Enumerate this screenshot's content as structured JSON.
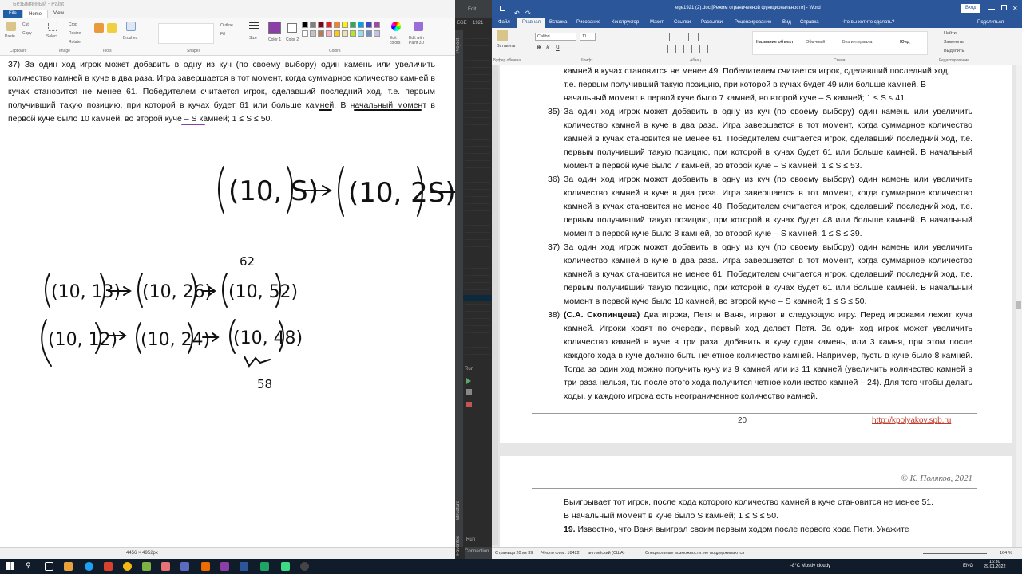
{
  "paint": {
    "title": "Безымянный - Paint",
    "tabs": [
      "File",
      "Home",
      "View"
    ],
    "ribbon": {
      "paste": "Paste",
      "cut": "Cut",
      "copy": "Copy",
      "select": "Select",
      "crop": "Crop",
      "resize": "Resize",
      "rotate": "Rotate",
      "brushes": "Brushes",
      "outline": "Outline",
      "fill": "Fill",
      "size": "Size",
      "color1": "Color 1",
      "color2": "Color 2",
      "edit_colors": "Edit colors",
      "edit_paint3d": "Edit with Paint 3D",
      "groups": [
        "Clipboard",
        "Image",
        "Tools",
        "Shapes",
        "Colors"
      ]
    },
    "task_text": "37) За один ход игрок может добавить в одну из куч (по своему выбору) один камень или увеличить количество камней в куче в два раза. Игра завершается в тот момент, когда суммарное количество камней в кучах становится не менее 61. Победителем считается игрок, сделавший последний ход, т.е. первым получивший такую позицию, при которой в кучах будет 61 или больше камней. В начальный момент в первой куче было 10 камней, во второй куче – S камней; 1 ≤ S ≤ 50.",
    "handwriting": {
      "line1_a": "(10, S)",
      "line1_b": "(10, 2S)",
      "label_62": "62",
      "row2": [
        "(10, 13)",
        "(10, 26)",
        "(10, 52)"
      ],
      "row3": [
        "(10, 12)",
        "(10, 24)",
        "(10, 48)"
      ],
      "label_58": "58"
    },
    "status": {
      "size": "4456 × 4952px"
    }
  },
  "ide": {
    "tabs": [
      "Edit",
      "EGE",
      "1921"
    ],
    "panel": "Run",
    "side_labels": [
      "Project",
      "Structure",
      "Favorites"
    ],
    "status": "Connection"
  },
  "word": {
    "title": "ege1921 (2).doc [Режим ограниченной функциональности] - Word",
    "login": "Вход",
    "tabs": [
      "Файл",
      "Главная",
      "Вставка",
      "Рисование",
      "Конструктор",
      "Макет",
      "Ссылки",
      "Рассылки",
      "Рецензирование",
      "Вид",
      "Справка",
      "Что вы хотите сделать?",
      "Поделиться"
    ],
    "ribbon": {
      "paste": "Вставить",
      "font_name": "Calibri",
      "font_size": "11",
      "styles": [
        "Название объект",
        "Обычный",
        "Без интервала",
        "Ючд"
      ],
      "find": "Найти",
      "replace": "Заменить",
      "select": "Выделить",
      "groups": [
        "Буфер обмена",
        "Шрифт",
        "Абзац",
        "Стили",
        "Редактирование"
      ]
    },
    "page1": {
      "top_lines": [
        "камней в кучах становится не менее 49. Победителем считается игрок, сделавший последний ход,",
        "т.е. первым получивший такую позицию, при которой в кучах будет 49 или больше камней. В",
        "начальный момент в первой куче было 7 камней, во второй куче – S камней; 1 ≤ S ≤ 41."
      ],
      "items": [
        {
          "num": "35)",
          "text": "За один ход игрок может добавить в одну из куч (по своему выбору) один камень или увеличить количество камней в куче в два раза. Игра завершается в тот момент, когда суммарное количество камней в кучах становится не менее 61. Победителем считается игрок, сделавший последний ход, т.е. первым получивший такую позицию, при которой в кучах будет 61 или больше камней. В начальный момент в первой куче было 7 камней, во второй куче – S камней; 1 ≤ S ≤ 53."
        },
        {
          "num": "36)",
          "text": "За один ход игрок может добавить в одну из куч (по своему выбору) один камень или увеличить количество камней в куче в два раза. Игра завершается в тот момент, когда суммарное количество камней в кучах становится не менее 48. Победителем считается игрок, сделавший последний ход, т.е. первым получивший такую позицию, при которой в кучах будет 48 или больше камней. В начальный момент в первой куче было 8 камней, во второй куче – S камней; 1 ≤ S ≤ 39."
        },
        {
          "num": "37)",
          "text": "За один ход игрок может добавить в одну из куч (по своему выбору) один камень или увеличить количество камней в куче в два раза. Игра завершается в тот момент, когда суммарное количество камней в кучах становится не менее 61. Победителем считается игрок, сделавший последний ход, т.е. первым получивший такую позицию, при которой в кучах будет 61 или больше камней. В начальный момент в первой куче было 10 камней, во второй куче – S камней; 1 ≤ S ≤ 50."
        }
      ],
      "item38_num": "38)",
      "item38_author": "(С.А. Скопинцева)",
      "item38_text": " Два игрока, Петя и Ваня, играют в следующую игру. Перед игроками лежит куча камней. Игроки ходят по очереди, первый ход делает Петя. За один ход игрок может увеличить количество камней в куче в три раза, добавить в кучу один камень, или 3 камня, при этом после каждого хода в куче должно быть нечетное количество камней. Например, пусть в куче было 8 камней. Тогда за один ход можно получить кучу из 9 камней или из 11 камней (увеличить количество камней в три раза нельзя, т.к. после этого хода получится четное количество камней – 24). Для того чтобы делать ходы, у каждого игрока есть неограниченное количество камней.",
      "page_number": "20",
      "footer_link": "http://kpolyakov.spb.ru"
    },
    "page2": {
      "header": "© К. Поляков, 2021",
      "line1": "Выигрывает тот игрок, после хода которого количество камней в куче становится не менее 51.",
      "line2": "В начальный момент в куче было S камней; 1 ≤ S ≤ 50.",
      "q_num": "19.",
      "q_text": " Известно, что Ваня выиграл своим первым ходом после первого хода Пети. Укажите"
    },
    "status": {
      "page": "Страница 20 из 39",
      "words": "Число слов: 18422",
      "lang": "английский (США)",
      "accessibility": "Специальные возможности: не поддерживаются",
      "zoom": "164 %"
    }
  },
  "taskbar": {
    "weather": "-8°C  Mostly cloudy",
    "lang": "ENG",
    "time": "16:30",
    "date": "29.01.2022"
  },
  "colors": {
    "paint_color1": "#8b3fa6",
    "word_blue": "#2b579a",
    "ide_bg": "#2b2b2b",
    "taskbar": "#111c2a",
    "link": "#c0392b"
  }
}
